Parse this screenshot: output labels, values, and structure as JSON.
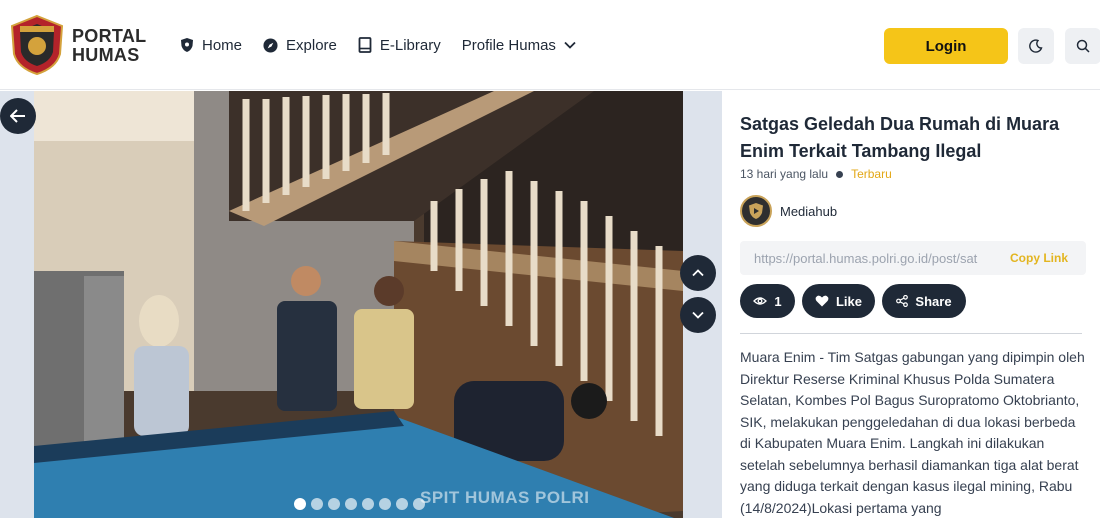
{
  "header": {
    "brand_line1": "PORTAL",
    "brand_line2": "HUMAS",
    "nav": [
      {
        "label": "Home",
        "icon": "shield-icon"
      },
      {
        "label": "Explore",
        "icon": "compass-icon"
      },
      {
        "label": "E-Library",
        "icon": "book-icon"
      },
      {
        "label": "Profile Humas",
        "icon": "chevron-down-icon"
      }
    ],
    "login_label": "Login",
    "theme_icon": "moon-icon",
    "search_icon": "search-icon"
  },
  "gallery": {
    "watermark": "SPIT HUMAS POLRI",
    "dots_total": 8,
    "active_dot": 0
  },
  "article": {
    "title": "Satgas Geledah Dua Rumah di Muara Enim Terkait Tambang Ilegal",
    "time": "13 hari yang lalu",
    "tag": "Terbaru",
    "author": "Mediahub",
    "link": "https://portal.humas.polri.go.id/post/sat",
    "copy_label": "Copy Link",
    "views": "1",
    "like_label": "Like",
    "share_label": "Share",
    "body": "Muara Enim - Tim Satgas gabungan yang dipimpin oleh Direktur Reserse Kriminal Khusus Polda Sumatera Selatan, Kombes Pol Bagus Suropratomo Oktobrianto, SIK, melakukan penggeledahan di dua lokasi berbeda di Kabupaten Muara Enim. Langkah ini dilakukan setelah sebelumnya berhasil diamankan tiga alat berat yang diduga terkait dengan kasus ilegal mining, Rabu (14/8/2024)Lokasi pertama yang"
  },
  "colors": {
    "accent": "#f5c518",
    "dark": "#1f2937",
    "tag": "#e3a818"
  }
}
